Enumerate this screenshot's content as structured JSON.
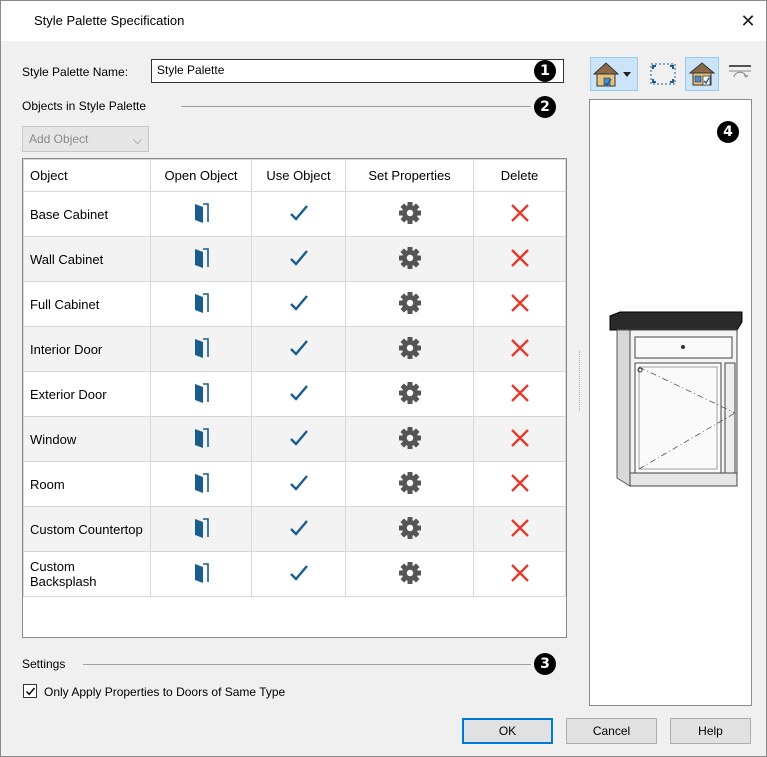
{
  "window": {
    "title": "Style Palette Specification",
    "close_glyph": "✕"
  },
  "name_field": {
    "label": "Style Palette Name:",
    "value": "Style Palette"
  },
  "objects_group": {
    "title": "Objects in Style Palette",
    "add_object_label": "Add Object",
    "add_object_chevron": "⌵"
  },
  "table": {
    "columns": [
      "Object",
      "Open Object",
      "Use Object",
      "Set Properties",
      "Delete"
    ],
    "rows": [
      {
        "name": "Base Cabinet",
        "open_icon": "open-object-icon",
        "use": true,
        "set_icon": "gear-icon",
        "delete_icon": "delete-x-icon"
      },
      {
        "name": "Wall Cabinet",
        "open_icon": "open-object-icon",
        "use": true,
        "set_icon": "gear-icon",
        "delete_icon": "delete-x-icon"
      },
      {
        "name": "Full Cabinet",
        "open_icon": "open-object-icon",
        "use": true,
        "set_icon": "gear-icon",
        "delete_icon": "delete-x-icon"
      },
      {
        "name": "Interior Door",
        "open_icon": "open-object-icon",
        "use": true,
        "set_icon": "gear-icon",
        "delete_icon": "delete-x-icon"
      },
      {
        "name": "Exterior Door",
        "open_icon": "open-object-icon",
        "use": true,
        "set_icon": "gear-icon",
        "delete_icon": "delete-x-icon"
      },
      {
        "name": "Window",
        "open_icon": "open-object-icon",
        "use": true,
        "set_icon": "gear-icon",
        "delete_icon": "delete-x-icon"
      },
      {
        "name": "Room",
        "open_icon": "open-object-icon",
        "use": true,
        "set_icon": "gear-icon",
        "delete_icon": "delete-x-icon"
      },
      {
        "name": "Custom Countertop",
        "open_icon": "open-object-icon",
        "use": true,
        "set_icon": "gear-icon",
        "delete_icon": "delete-x-icon"
      },
      {
        "name": "Custom Backsplash",
        "open_icon": "open-object-icon",
        "use": true,
        "set_icon": "gear-icon",
        "delete_icon": "delete-x-icon"
      }
    ]
  },
  "settings_group": {
    "title": "Settings",
    "checkbox_label": "Only Apply Properties to Doors of Same Type",
    "checkbox_checked": true
  },
  "buttons": {
    "ok": "OK",
    "cancel": "Cancel",
    "help": "Help"
  },
  "callouts": [
    "1",
    "2",
    "3",
    "4"
  ],
  "toolbar": {
    "icons": [
      "view-type-icon",
      "fill-window-icon",
      "preview-options-icon",
      "split-view-icon"
    ]
  },
  "colors": {
    "accent": "#1a5d8c",
    "check": "#1a5d8c",
    "delete": "#e23b2e",
    "gear": "#555555",
    "default_button_border": "#0078d7"
  }
}
